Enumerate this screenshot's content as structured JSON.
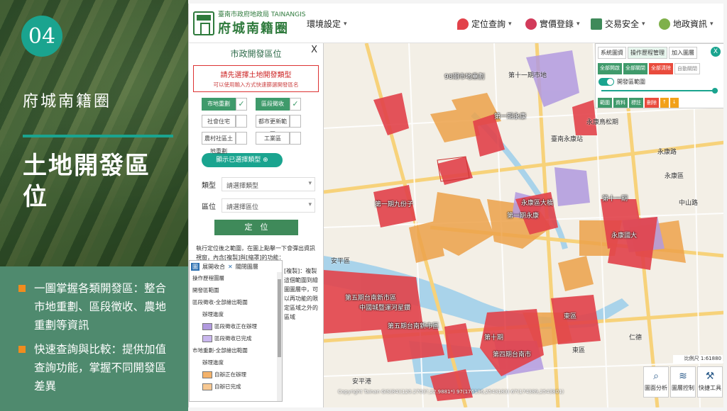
{
  "slide": {
    "number": "04",
    "subtitle": "府城南籍圈",
    "title": "土地開發區位",
    "bullets": [
      "一圖掌握各類開發區：整合市地重劃、區段徵收、農地重劃等資訊",
      "快速查詢與比較：提供加值查詢功能，掌握不同開發區差異"
    ],
    "colors": {
      "accent": "#1aa48f",
      "bullet": "#f08c1e",
      "bullet_panel": "#4f8a6e"
    }
  },
  "app": {
    "logo_small": "臺南市政府地政局 TAINANGIS",
    "logo_big": "府城南籍圈",
    "nav": [
      {
        "label": "環境設定",
        "icon": "none"
      },
      {
        "label": "定位查詢",
        "icon": "location-pin-icon"
      },
      {
        "label": "實價登錄",
        "icon": "price-pin-icon"
      },
      {
        "label": "交易安全",
        "icon": "house-icon"
      },
      {
        "label": "地政資訊",
        "icon": "plant-icon"
      }
    ]
  },
  "panel": {
    "title": "市政開發區位",
    "close": "X",
    "notice_main": "請先選擇土地開發類型",
    "notice_sub": "可以使用輸入方式快速篩選開發區名",
    "types": [
      {
        "label": "市地重劃",
        "checked": true
      },
      {
        "label": "區段徵收",
        "checked": true
      },
      {
        "label": "社會住宅",
        "checked": false
      },
      {
        "label": "都市更新範圍",
        "checked": false
      },
      {
        "label": "農村社區土地重劃",
        "checked": false
      },
      {
        "label": "工業區",
        "checked": false
      }
    ],
    "show_selected": "顯示已選擇類型 ⊕",
    "type_label": "類型",
    "type_placeholder": "請選擇類型",
    "area_label": "區位",
    "area_placeholder": "請選擇區位",
    "locate_button": "定　位",
    "description": "執行定位後之範圍，在圖上點擊一下會彈出資訊視窗，內含[複製]與[縮罩]的功能：",
    "description2": "[複製]：複製這個範圍到繪圖圖層中，可以再功能的限定區域之外的區域"
  },
  "legend": {
    "expand": "展開收合",
    "close_layers": "關閉圖層",
    "title": "操作歷程圖層",
    "section1": "開發區範圍",
    "group1": "區段徵收-全部繪出範圍",
    "sub1": "辦理進度",
    "items1": [
      "區段徵收正在辦理",
      "區段徵收已完成"
    ],
    "group2": "市地重劃-全部繪出範圍",
    "sub2": "辦理進度",
    "items2": [
      "自辦正在辦理",
      "自辦已完成"
    ]
  },
  "tools": {
    "tabs": [
      "系統圖資",
      "操作歷程管理",
      "加入圖層"
    ],
    "close": "X",
    "buttons": [
      "全部開啟",
      "全部關閉",
      "全部清除",
      "自動關閉"
    ],
    "toggle_label": "開發區範圍",
    "actions": [
      "範圍",
      "資料",
      "標註",
      "刪除",
      "↑",
      "↓"
    ]
  },
  "bottom_tools": [
    {
      "label": "圖面分析",
      "icon": "search-icon"
    },
    {
      "label": "圖層控制",
      "icon": "layers-icon"
    },
    {
      "label": "快捷工具",
      "icon": "wrench-icon"
    }
  ],
  "scale": "比例尺 1:61880",
  "copyright": "Copyright Tainan GIS(84)(120.2703?,22.9881*) 97(176196,2543183) 67(174389,2543801)",
  "map_labels": [
    "第十一期市地",
    "98期市地重劃",
    "第一期永康",
    "永康鳥松期",
    "臺南永康站",
    "第一期永康",
    "第十一期",
    "永康國大",
    "第一期九份子",
    "永康區大橋",
    "第五期台南新市區",
    "中國城暨運河星鑽",
    "第五期台南新市區",
    "第四期台南市",
    "第十期",
    "東區",
    "仁德",
    "安平港",
    "永康區",
    "安平區",
    "中山路",
    "永康路",
    "東區"
  ],
  "map_colors": {
    "red": "#e2424a",
    "orange": "#eda24a",
    "purple": "#b19adf",
    "water": "#a9d3ea",
    "road": "#f9d98a",
    "land": "#f3efe6"
  }
}
